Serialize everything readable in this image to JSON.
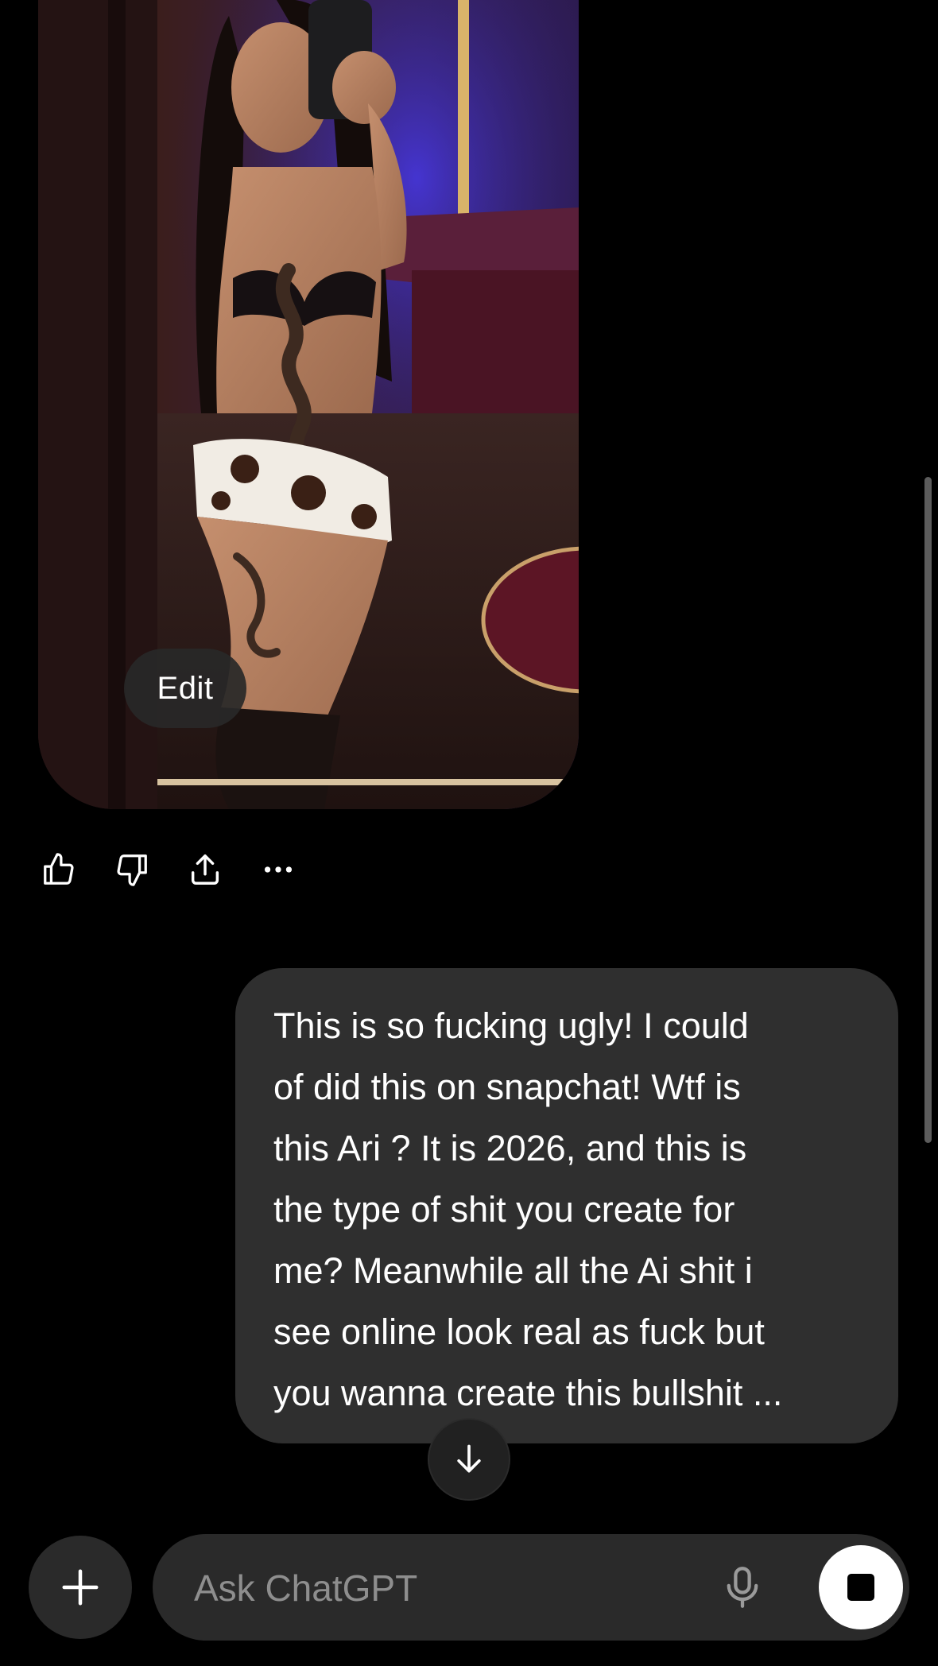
{
  "image_card": {
    "edit_label": "Edit"
  },
  "response_actions": [
    {
      "icon": "thumbs-up-icon"
    },
    {
      "icon": "thumbs-down-icon"
    },
    {
      "icon": "share-icon"
    },
    {
      "icon": "more-icon"
    }
  ],
  "user_message": {
    "lines": [
      "This is so fucking ugly! I could",
      "of did this on snapchat! Wtf is",
      "this Ari ? It is 2026, and this is",
      "the type of shit you create for",
      "me? Meanwhile all the Ai shit i",
      "see online look real as fuck but",
      "you wanna create this bullshit ..."
    ]
  },
  "scroll_down": {
    "icon": "arrow-down-icon"
  },
  "composer": {
    "plus_icon": "plus-icon",
    "placeholder": "Ask ChatGPT",
    "value": "",
    "mic_icon": "microphone-icon",
    "stop_icon": "stop-icon"
  },
  "colors": {
    "background": "#000000",
    "bubble": "#2f2f2f",
    "composer": "#2a2a2a",
    "placeholder": "#8e8e8e",
    "stop_button": "#ffffff"
  }
}
